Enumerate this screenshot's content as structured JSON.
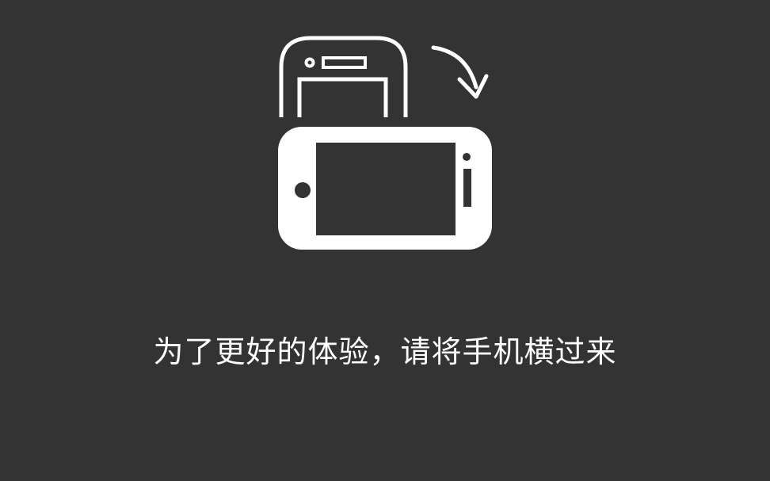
{
  "colors": {
    "background": "#333333",
    "foreground": "#ffffff"
  },
  "icons": {
    "portrait_phone": "portrait-phone-outline-icon",
    "rotate_arrow": "rotate-clockwise-arrow-icon",
    "landscape_phone": "landscape-phone-icon"
  },
  "message": "为了更好的体验，请将手机横过来"
}
